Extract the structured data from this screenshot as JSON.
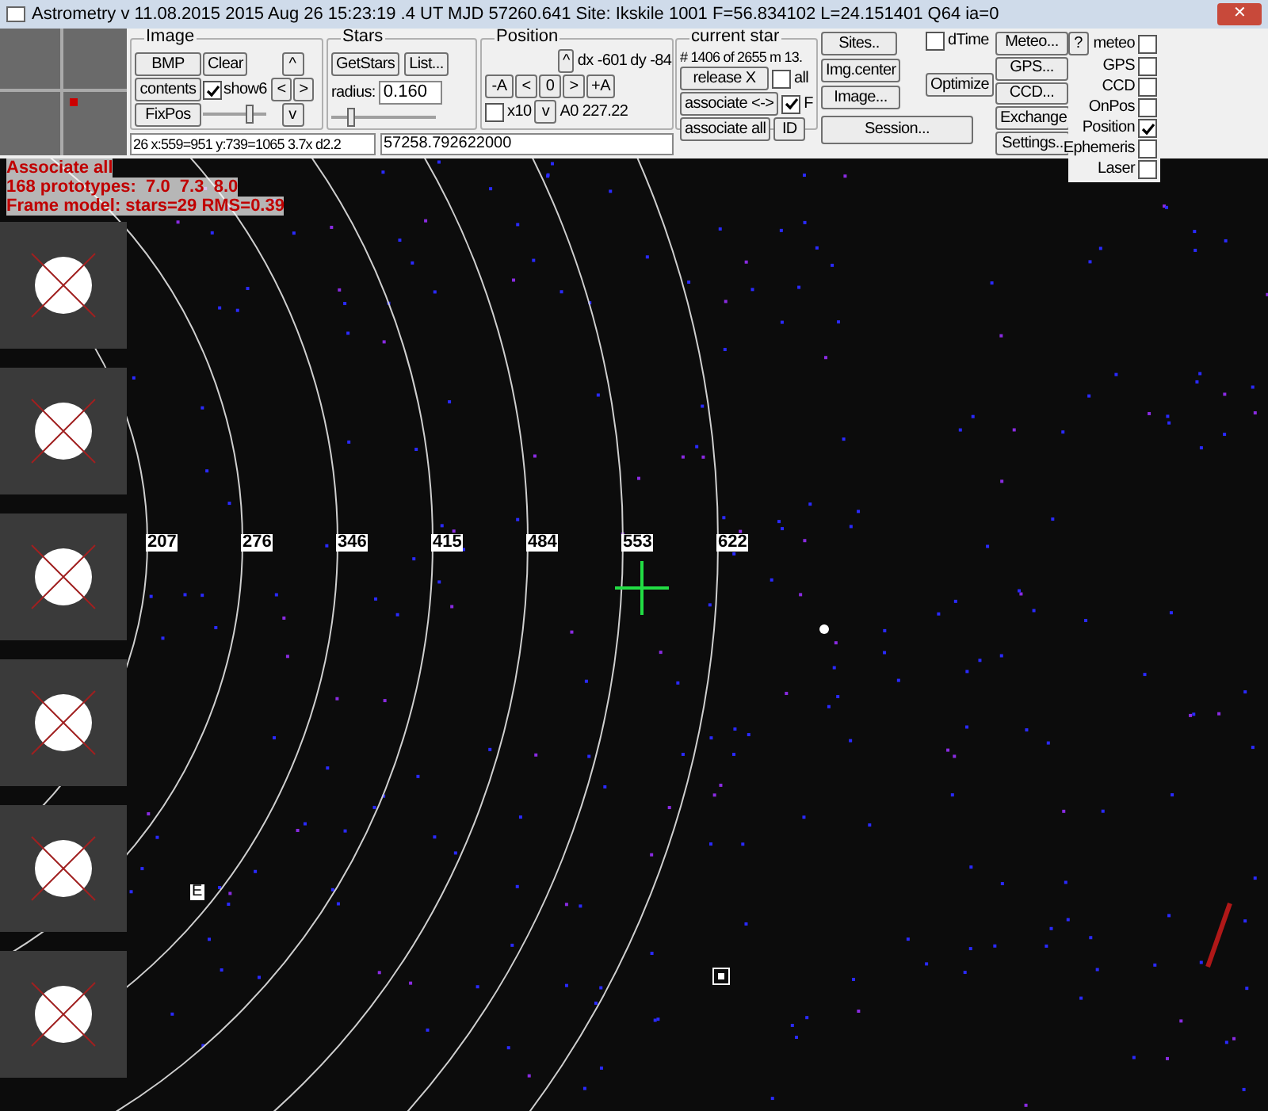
{
  "window": {
    "title": "Astrometry v 11.08.2015 2015 Aug 26 15:23:19 .4 UT MJD 57260.641 Site: Ikskile 1001  F=56.834102 L=24.151401 Q64 ia=0",
    "close": "✕"
  },
  "image_group": {
    "title": "Image",
    "buttons": [
      "BMP",
      "contents",
      "FixPos"
    ],
    "clear": "Clear",
    "show6": {
      "label": "show6",
      "checked": true
    },
    "arrows": [
      "^",
      "<",
      ">",
      "v"
    ],
    "slider": {
      "level": 0.75
    }
  },
  "stars_group": {
    "title": "Stars",
    "get_stars": "GetStars",
    "list": "List...",
    "radius_label": "radius:",
    "radius_value": "0.160",
    "slider": {
      "level": 0.2
    }
  },
  "position_group": {
    "title": "Position",
    "up": "^",
    "dx": "dx -601",
    "dy": "dy -84",
    "minus_a": "-A",
    "left": "<",
    "zero": "0",
    "right": ">",
    "plus_a": "+A",
    "x10": {
      "label": "x10",
      "checked": false
    },
    "down": "v",
    "a0": "A0 227.22"
  },
  "status_fields": [
    "26 x:559=951 y:739=1065 3.7x d2.2",
    "57258.792622000"
  ],
  "current_star": {
    "title": "current star",
    "info": "# 1406 of 2655 m 13.",
    "release": "release X",
    "all": {
      "label": "all",
      "checked": false
    },
    "associate": "associate <->",
    "f": {
      "label": "F",
      "checked": true
    },
    "associate_all": "associate all",
    "id": "ID"
  },
  "buttons": {
    "sites": "Sites..",
    "img_center": "Img.center",
    "image": "Image...",
    "session": "Session...",
    "dtime": {
      "label": "dTime",
      "checked": false
    },
    "optimize": "Optimize",
    "meteo": "Meteo...",
    "gps": "GPS...",
    "ccd": "CCD...",
    "exchange": "Exchange",
    "settings": "Settings..",
    "help": "?"
  },
  "toggles": [
    {
      "label": "meteo",
      "checked": false
    },
    {
      "label": "GPS",
      "checked": false
    },
    {
      "label": "CCD",
      "checked": false
    },
    {
      "label": "OnPos",
      "checked": false
    },
    {
      "label": "Position",
      "checked": true
    },
    {
      "label": "Ephemeris",
      "checked": false
    },
    {
      "label": "Laser",
      "checked": false
    }
  ],
  "overlay_lines": [
    "Associate all",
    "168 prototypes:  7.0  7.3  8.0",
    "Frame model: stars=29 RMS=0.39"
  ],
  "ring_labels": [
    "207",
    "276",
    "346",
    "415",
    "484",
    "553",
    "622"
  ],
  "marker_label": "E"
}
